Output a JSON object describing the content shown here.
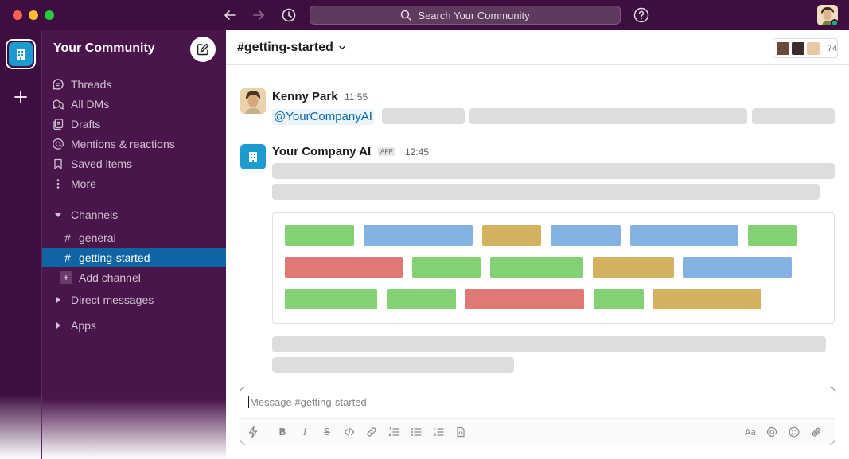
{
  "window": {
    "search_placeholder": "Search Your Community"
  },
  "workspace": {
    "name": "Your Community"
  },
  "sidebar": {
    "nav_items": [
      {
        "label": "Threads",
        "icon": "threads-icon"
      },
      {
        "label": "All DMs",
        "icon": "dms-icon"
      },
      {
        "label": "Drafts",
        "icon": "drafts-icon"
      },
      {
        "label": "Mentions & reactions",
        "icon": "at-icon"
      },
      {
        "label": "Saved items",
        "icon": "bookmark-icon"
      },
      {
        "label": "More",
        "icon": "more-vertical-icon"
      }
    ],
    "channels_header": "Channels",
    "channels": [
      {
        "name": "general",
        "active": false
      },
      {
        "name": "getting-started",
        "active": true
      }
    ],
    "add_channel": "Add channel",
    "direct_messages_header": "Direct messages",
    "apps_header": "Apps"
  },
  "channel": {
    "title": "#getting-started",
    "member_count": "74"
  },
  "messages": [
    {
      "author": "Kenny Park",
      "time": "11:55",
      "mention": "@YourCompanyAI"
    },
    {
      "author": "Your Company AI",
      "badge": "APP",
      "time": "12:45"
    }
  ],
  "card_blocks": {
    "colors": {
      "green": "#82d175",
      "blue": "#84b2e3",
      "gold": "#d4b061",
      "red": "#e07873"
    },
    "rows": [
      [
        "green",
        "blue",
        "gold",
        "blue",
        "blue",
        "green"
      ],
      [
        "red",
        "green",
        "green",
        "gold",
        "blue"
      ],
      [
        "green",
        "green",
        "red",
        "green",
        "gold"
      ]
    ]
  },
  "composer": {
    "placeholder": "Message #getting-started"
  },
  "colors": {
    "titlebar": "#3f0e40",
    "sidebar": "#4a154b",
    "active_channel": "#1164a3",
    "mention_text": "#1264a3",
    "app_icon": "#1d9bd1"
  }
}
